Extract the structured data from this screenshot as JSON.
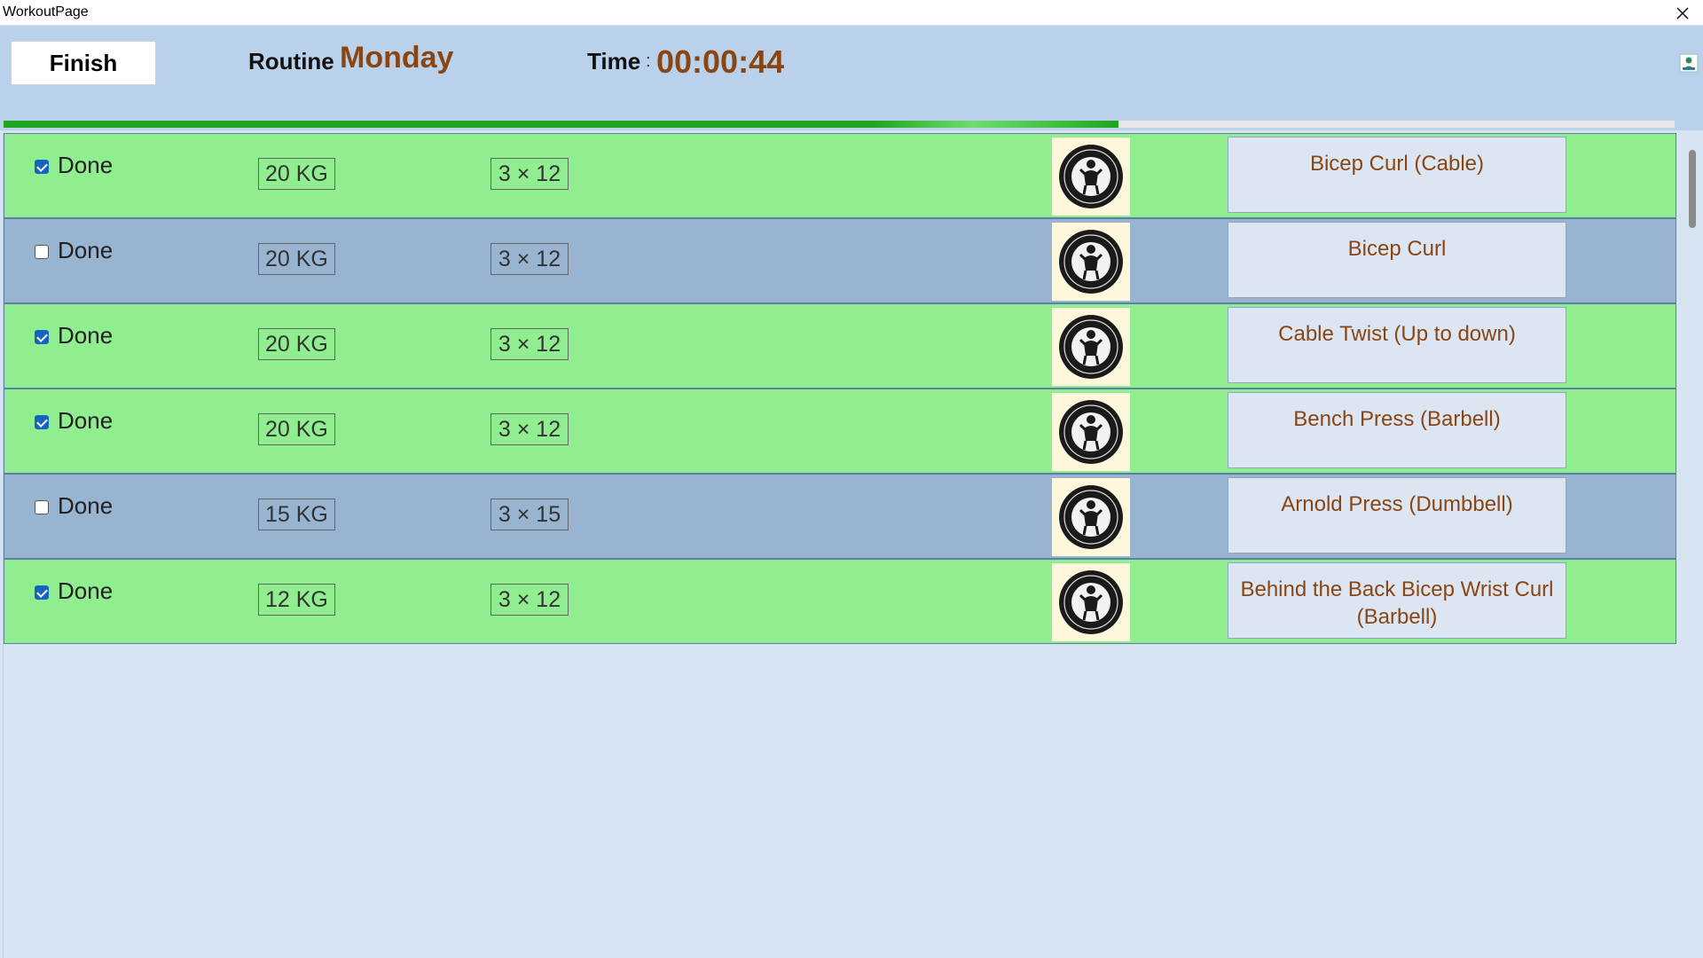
{
  "window": {
    "title": "WorkoutPage",
    "close_icon": "close-icon"
  },
  "header": {
    "finish_label": "Finish",
    "routine_label": "Routine",
    "routine_name": "Monday",
    "time_label": "Time",
    "time_separator": ":",
    "time_value": "00:00:44",
    "corner_icon": "person-icon"
  },
  "progress": {
    "percent": 66.7
  },
  "colors": {
    "done_row": "#90ee90",
    "pending_row": "#99b4d1",
    "accent": "#8b4513",
    "progress": "#1fa51f"
  },
  "exercises": [
    {
      "done": true,
      "done_label": "Done",
      "weight": "20 KG",
      "sets_reps": "3 × 12",
      "name": "Bicep Curl (Cable)"
    },
    {
      "done": false,
      "done_label": "Done",
      "weight": "20 KG",
      "sets_reps": "3 × 12",
      "name": "Bicep Curl"
    },
    {
      "done": true,
      "done_label": "Done",
      "weight": "20 KG",
      "sets_reps": "3 × 12",
      "name": "Cable Twist (Up to down)"
    },
    {
      "done": true,
      "done_label": "Done",
      "weight": "20 KG",
      "sets_reps": "3 × 12",
      "name": "Bench Press (Barbell)"
    },
    {
      "done": false,
      "done_label": "Done",
      "weight": "15 KG",
      "sets_reps": "3 × 15",
      "name": "Arnold Press (Dumbbell)"
    },
    {
      "done": true,
      "done_label": "Done",
      "weight": "12 KG",
      "sets_reps": "3 × 12",
      "name": "Behind the Back Bicep Wrist Curl (Barbell)"
    }
  ]
}
